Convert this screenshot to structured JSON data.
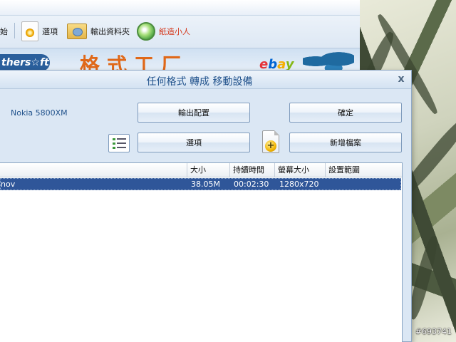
{
  "toolbar": {
    "partial_left_text": "始",
    "options_label": "選項",
    "output_folder_label": "輸出資料夾",
    "paper_man_label": "紙造小人"
  },
  "banner": {
    "brand_partial": "thers☆ft",
    "app_title_partial": "格式工厂",
    "ebay": [
      "e",
      "b",
      "a",
      "y"
    ]
  },
  "dialog": {
    "title": "任何格式 轉成 移動設備",
    "close_glyph": "x",
    "device": "Nokia 5800XM",
    "buttons": {
      "output_config": "輸出配置",
      "ok": "確定",
      "options": "選項",
      "add_file": "新增檔案"
    }
  },
  "file_list": {
    "columns": [
      "大小",
      "持續時間",
      "螢幕大小",
      "設置範圍"
    ],
    "rows": [
      {
        "name": "nov",
        "size": "38.05M",
        "duration": "00:02:30",
        "resolution": "1280x720",
        "range": ""
      }
    ]
  },
  "watermark": "#693741",
  "colors": {
    "accent": "#23548d",
    "selection": "#2f5699",
    "link": "#d4381c",
    "brand_orange": "#e06818"
  }
}
